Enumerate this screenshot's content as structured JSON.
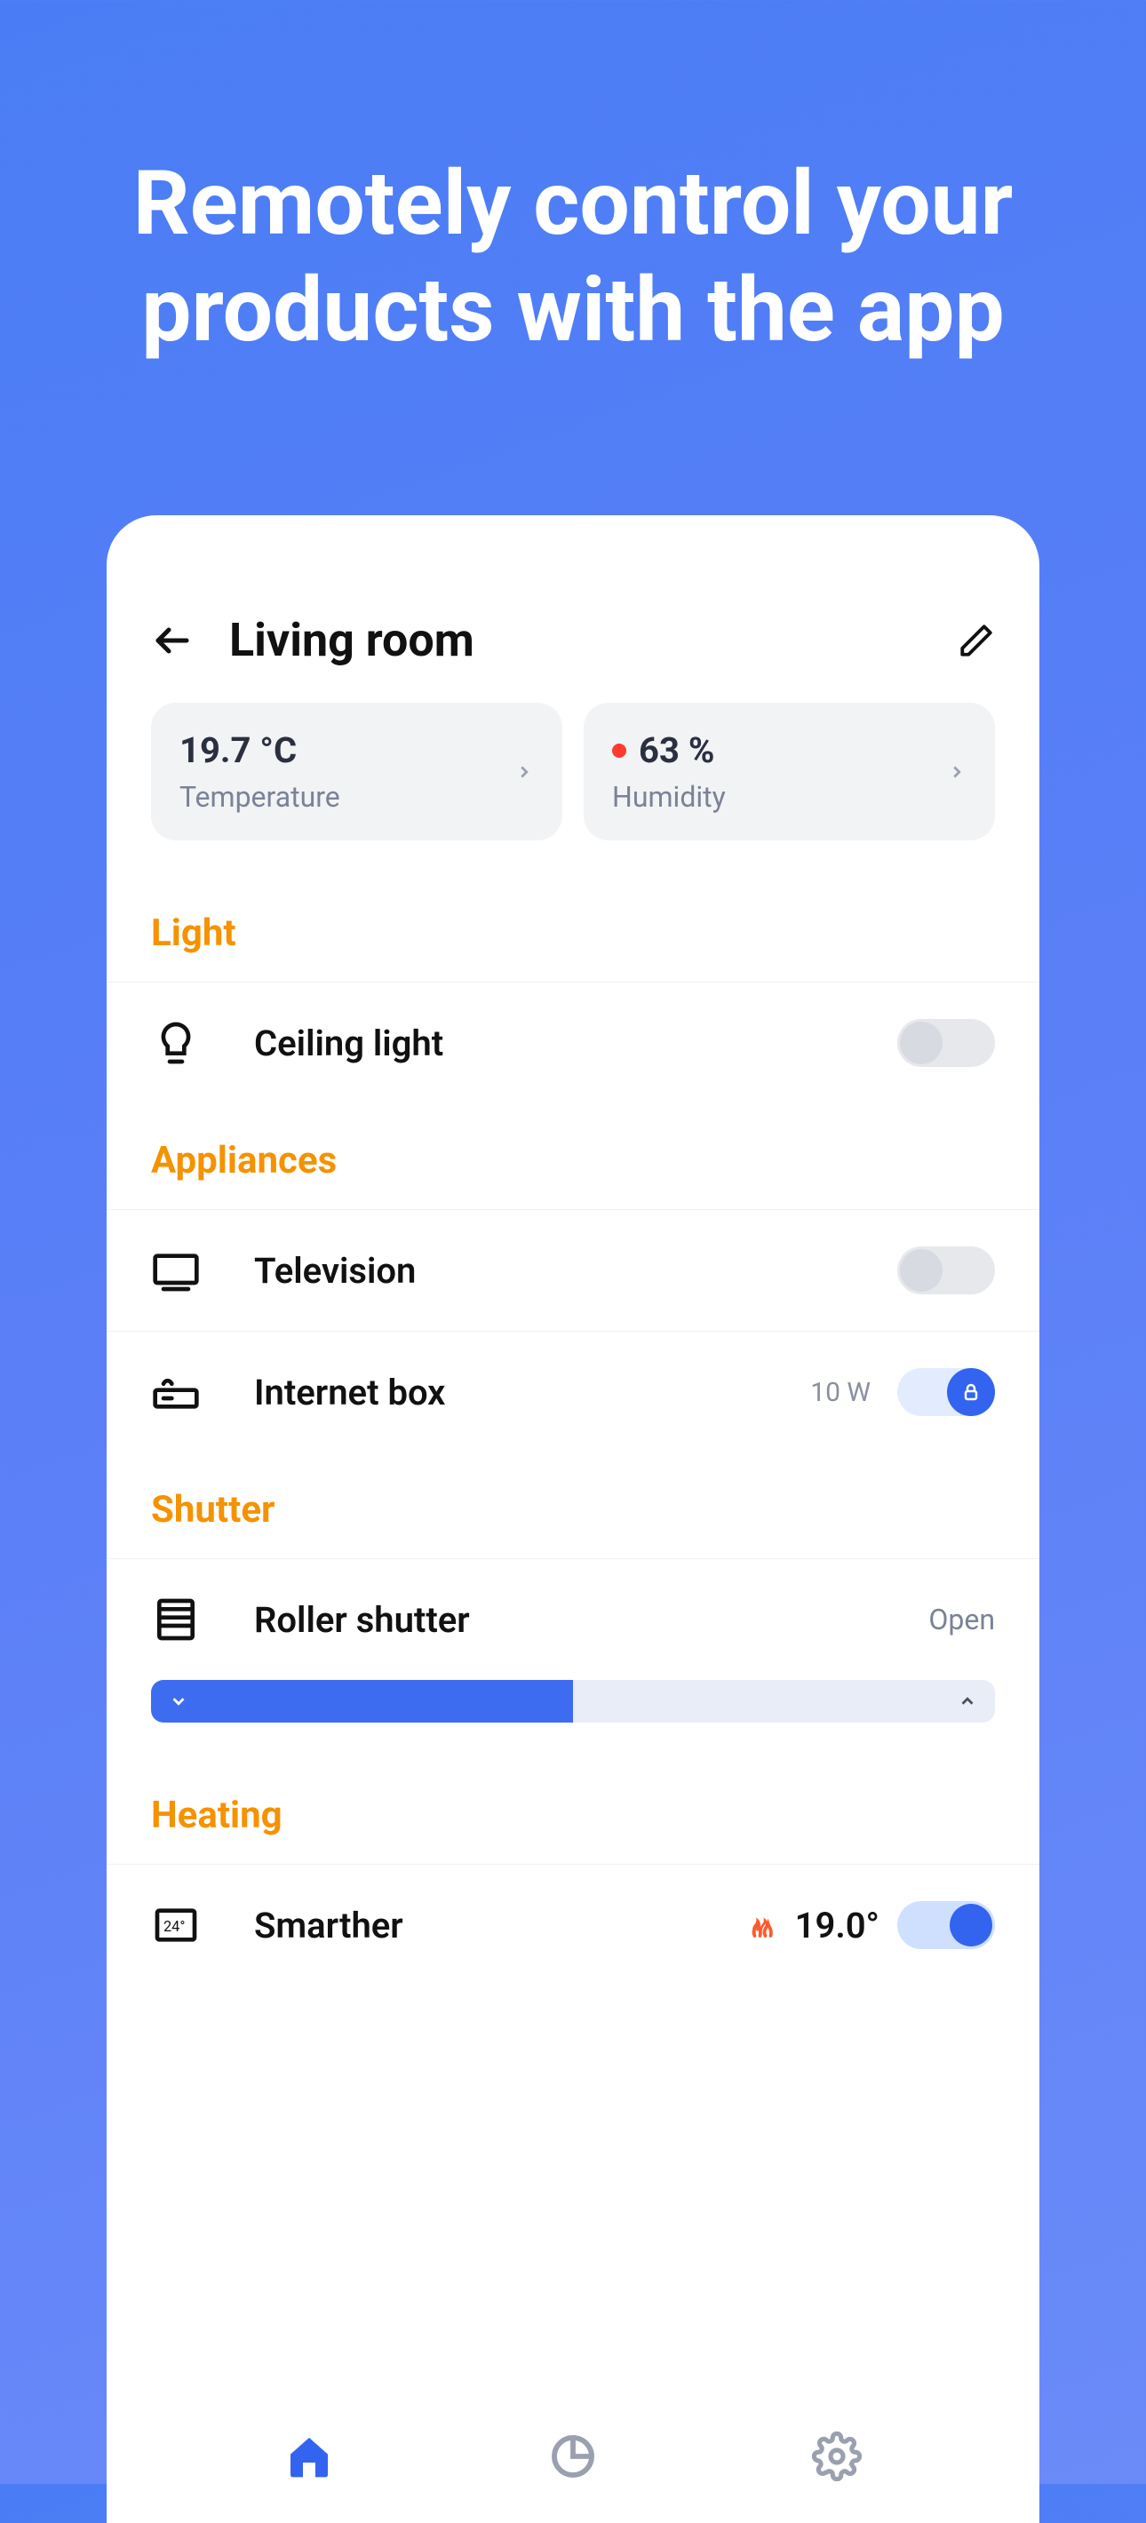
{
  "marketing_headline": "Remotely control your products with the app",
  "header": {
    "title": "Living room"
  },
  "cards": {
    "temperature": {
      "value": "19.7 °C",
      "label": "Temperature"
    },
    "humidity": {
      "value": "63 %",
      "label": "Humidity"
    }
  },
  "sections": {
    "light": {
      "title": "Light",
      "items": [
        {
          "label": "Ceiling light"
        }
      ]
    },
    "appliances": {
      "title": "Appliances",
      "items": [
        {
          "label": "Television"
        },
        {
          "label": "Internet box",
          "sub": "10 W"
        }
      ]
    },
    "shutter": {
      "title": "Shutter",
      "items": [
        {
          "label": "Roller shutter",
          "status": "Open"
        }
      ]
    },
    "heating": {
      "title": "Heating",
      "items": [
        {
          "label": "Smarther",
          "temp": "19.0°"
        }
      ]
    }
  }
}
